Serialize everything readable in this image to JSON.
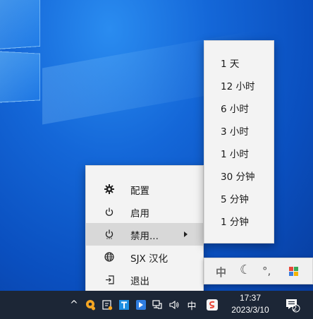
{
  "context_menu": {
    "items": [
      {
        "label": "配置",
        "icon": "gear-icon"
      },
      {
        "label": "启用",
        "icon": "power-icon"
      },
      {
        "label": "禁用...",
        "icon": "power-icon",
        "has_submenu": true
      },
      {
        "label": "SJX 汉化",
        "icon": "globe-icon"
      },
      {
        "label": "退出",
        "icon": "exit-icon"
      }
    ]
  },
  "submenu": {
    "items": [
      "1 天",
      "12 小时",
      "6 小时",
      "3 小时",
      "1 小时",
      "30 分钟",
      "5 分钟",
      "1 分钟"
    ]
  },
  "ime_panel": {
    "mode": "中",
    "moon": "☾",
    "punct": "°,"
  },
  "taskbar": {
    "chevron": "^",
    "ime_indicator": "中",
    "time": "17:37",
    "date": "2023/3/10",
    "notification_count": "2"
  },
  "colors": {
    "taskbar": "#1c2636",
    "menu_bg": "#f3f3f3",
    "hover": "#d8d8d8",
    "desktop": "#0a57c9"
  }
}
